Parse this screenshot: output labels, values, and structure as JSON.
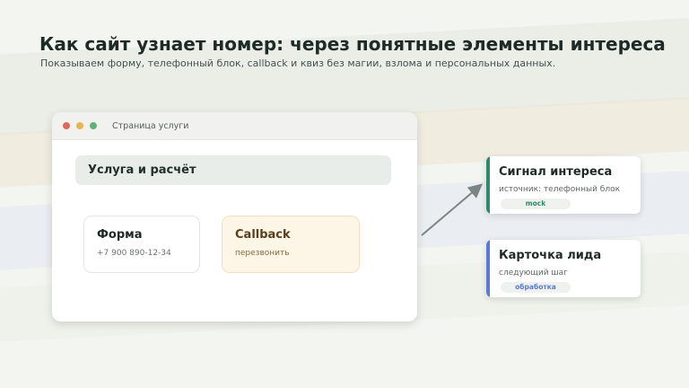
{
  "header": {
    "title": "Как сайт узнает номер: через понятные элементы интереса",
    "subtitle": "Показываем форму, телефонный блок, callback и квиз без магии, взлома и персональных данных."
  },
  "browser": {
    "window_title": "Страница услуги",
    "service_header": "Услуга и расчёт",
    "form_block": {
      "title": "Форма",
      "phone": "+7 900 890-12-34"
    },
    "callback_block": {
      "title": "Callback",
      "subtitle": "перезвонить"
    }
  },
  "cards": {
    "signal": {
      "title": "Сигнал интереса",
      "subtitle": "источник: телефонный блок",
      "badge": "mock"
    },
    "lead": {
      "title": "Карточка лида",
      "subtitle": "следующий шаг",
      "badge": "обработка"
    }
  },
  "colors": {
    "signal_accent": "#2f8a6c",
    "lead_accent": "#5b7ad6",
    "callback_bg": "#fdf5e6"
  }
}
